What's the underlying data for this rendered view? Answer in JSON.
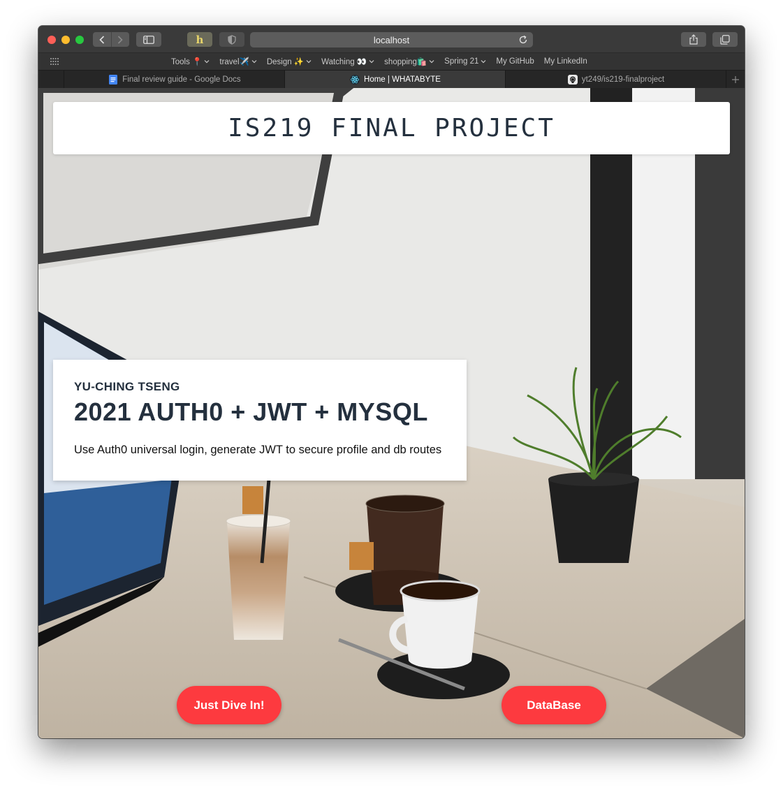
{
  "browser": {
    "address": "localhost",
    "favorites": [
      {
        "label": "Tools 📍",
        "has_menu": true
      },
      {
        "label": "travel✈️",
        "has_menu": true
      },
      {
        "label": "Design ✨",
        "has_menu": true
      },
      {
        "label": "Watching 👀",
        "has_menu": true
      },
      {
        "label": "shopping🛍️",
        "has_menu": true
      },
      {
        "label": "Spring 21",
        "has_menu": true
      },
      {
        "label": "My GitHub",
        "has_menu": false
      },
      {
        "label": "My LinkedIn",
        "has_menu": false
      }
    ],
    "tabs": [
      {
        "title": "Final review guide - Google Docs",
        "icon": "google-docs-icon",
        "active": false
      },
      {
        "title": "Home | WHATABYTE",
        "icon": "react-icon",
        "active": true
      },
      {
        "title": "yt249/is219-finalproject",
        "icon": "github-icon",
        "active": false
      }
    ],
    "extension_glyph": "h"
  },
  "page": {
    "title": "IS219 FINAL PROJECT",
    "hero": {
      "name": "YU-CHING TSENG",
      "title": "2021 AUTH0 + JWT + MYSQL",
      "description": "Use Auth0 universal login, generate JWT to secure profile and db routes"
    },
    "buttons": {
      "dive": "Just Dive In!",
      "database": "DataBase"
    }
  },
  "colors": {
    "accent": "#fd3a3f",
    "heading": "#24303e"
  }
}
